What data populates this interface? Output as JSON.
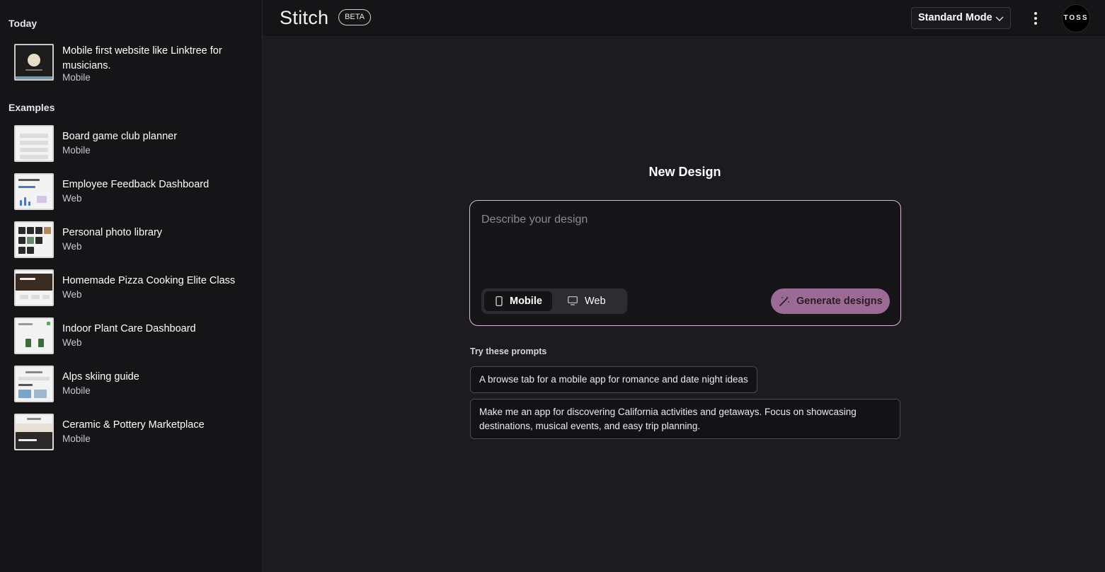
{
  "sidebar": {
    "today_label": "Today",
    "examples_label": "Examples",
    "today": [
      {
        "title": "Mobile first website like Linktree for musicians.",
        "type": "Mobile"
      }
    ],
    "examples": [
      {
        "title": "Board game club planner",
        "type": "Mobile"
      },
      {
        "title": "Employee Feedback Dashboard",
        "type": "Web"
      },
      {
        "title": "Personal photo library",
        "type": "Web"
      },
      {
        "title": "Homemade Pizza Cooking Elite Class",
        "type": "Web"
      },
      {
        "title": "Indoor Plant Care Dashboard",
        "type": "Web"
      },
      {
        "title": "Alps skiing guide",
        "type": "Mobile"
      },
      {
        "title": "Ceramic & Pottery Marketplace",
        "type": "Mobile"
      }
    ]
  },
  "header": {
    "app_name": "Stitch",
    "badge": "BETA",
    "mode_selected": "Standard Mode",
    "avatar_text": "TOSS"
  },
  "main": {
    "title": "New Design",
    "input_placeholder": "Describe your design",
    "input_value": "",
    "device_toggle": {
      "mobile": "Mobile",
      "web": "Web",
      "selected": "Mobile"
    },
    "generate_label": "Generate designs",
    "try_label": "Try these prompts",
    "prompts": [
      "A browse tab for a mobile app for romance and date night ideas",
      "Make me an app for discovering California activities and getaways. Focus on showcasing destinations, musical events, and easy trip planning."
    ]
  },
  "colors": {
    "background": "#1c1c20",
    "sidebar": "#151518",
    "accent_border": "#e2b6dc",
    "generate_button": "#9b6b95"
  }
}
